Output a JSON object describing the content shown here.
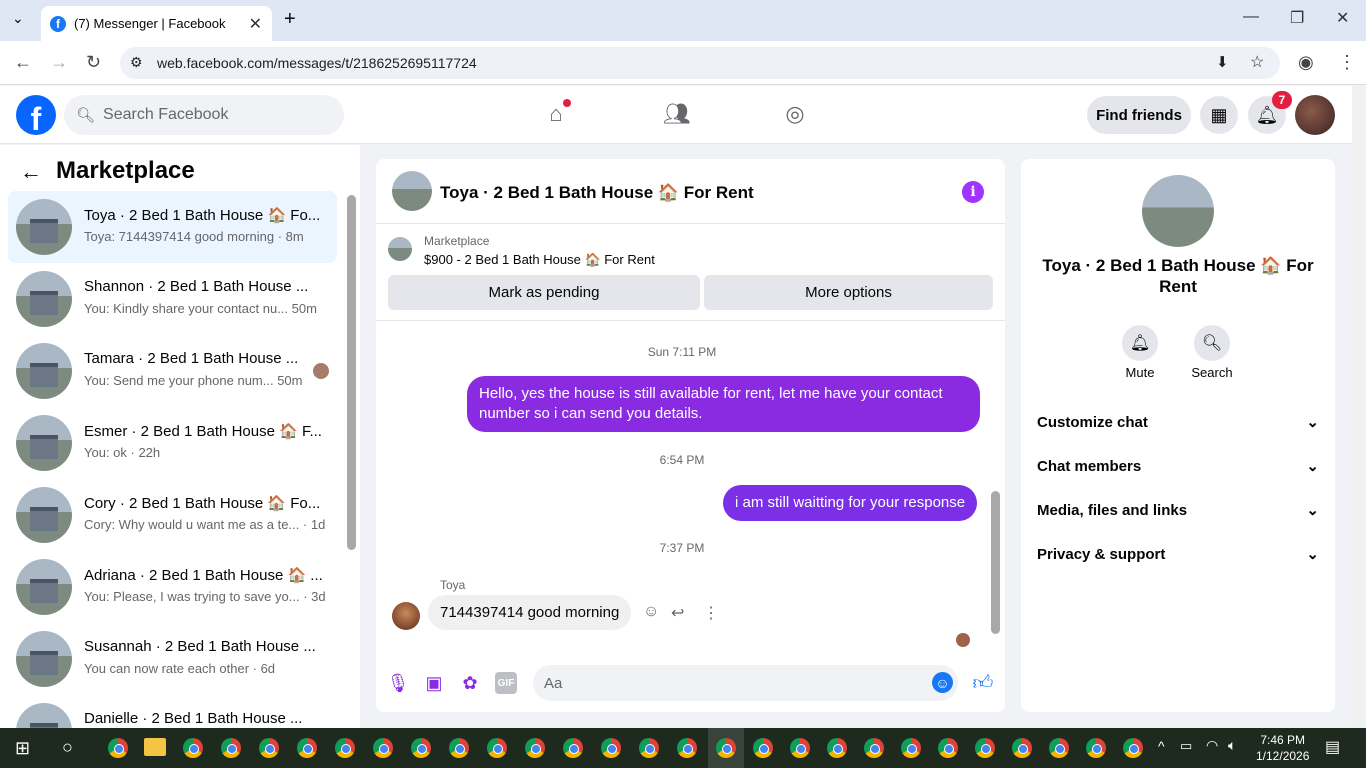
{
  "browser": {
    "tab_title": "(7) Messenger | Facebook",
    "url": "web.facebook.com/messages/t/2186252695117724"
  },
  "fb": {
    "search_placeholder": "Search Facebook",
    "find_friends": "Find friends",
    "notif_count": "7"
  },
  "sidebar": {
    "title": "Marketplace",
    "conversations": [
      {
        "name": "Toya · 2 Bed 1 Bath House 🏠 Fo...",
        "snippet": "Toya: 7144397414 good morning · 8m"
      },
      {
        "name": "Shannon · 2 Bed 1 Bath House ...",
        "snippet": "You: Kindly share your contact nu...  50m"
      },
      {
        "name": "Tamara · 2 Bed 1 Bath House ...",
        "snippet": "You: Send me your phone num...  50m"
      },
      {
        "name": "Esmer · 2 Bed 1 Bath House 🏠 F...",
        "snippet": "You: ok · 22h"
      },
      {
        "name": "Cory · 2 Bed 1 Bath House 🏠 Fo...",
        "snippet": "Cory: Why would u want me as a te... · 1d"
      },
      {
        "name": "Adriana · 2 Bed 1 Bath House 🏠 ...",
        "snippet": "You: Please, I was trying to save yo... · 3d"
      },
      {
        "name": "Susannah · 2 Bed 1 Bath House ...",
        "snippet": "You can now rate each other · 6d"
      },
      {
        "name": "Danielle · 2 Bed 1 Bath House ...",
        "snippet": ""
      }
    ]
  },
  "chat": {
    "title": "Toya · 2 Bed 1 Bath House 🏠 For Rent",
    "marketplace_label": "Marketplace",
    "listing": "$900 - 2 Bed 1 Bath House 🏠 For Rent",
    "mark_pending": "Mark as pending",
    "more_options": "More options",
    "messages": [
      {
        "stamp": "Sun 7:11 PM",
        "text": "Hello, yes the house is still available for rent, let me have your contact number so i can send you  details."
      },
      {
        "stamp": "6:54 PM",
        "text": "i am still waitting for your response"
      },
      {
        "stamp": "7:37 PM",
        "sender": "Toya",
        "text": "7144397414 good morning"
      }
    ],
    "input_placeholder": "Aa"
  },
  "info": {
    "name": "Toya · 2 Bed 1 Bath House 🏠 For Rent",
    "mute": "Mute",
    "search": "Search",
    "sections": [
      "Customize chat",
      "Chat members",
      "Media, files and links",
      "Privacy & support"
    ]
  },
  "taskbar": {
    "time": "7:46 PM",
    "date": "1/12/2026"
  },
  "colors": {
    "accent": "#8a2be2",
    "fb_blue": "#0866ff"
  }
}
